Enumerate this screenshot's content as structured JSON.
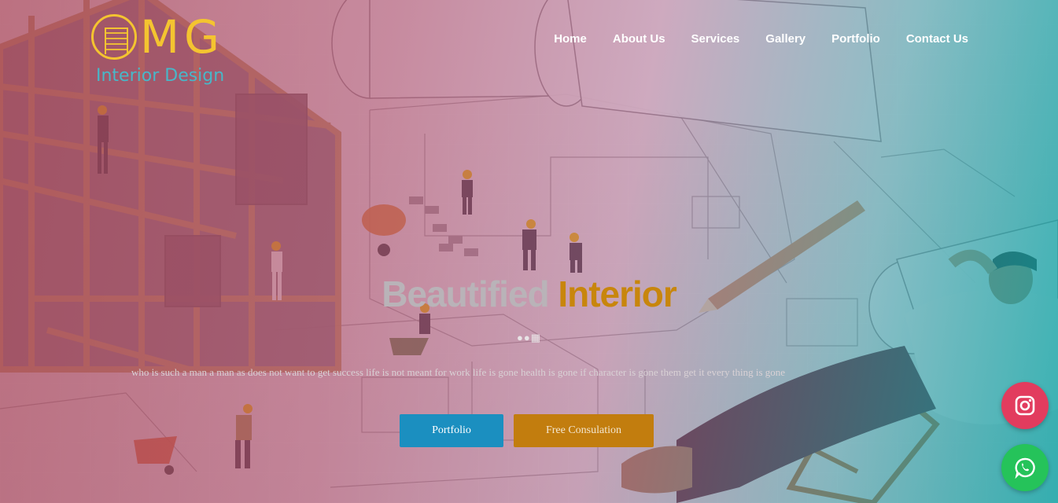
{
  "brand": {
    "logo_letters": "MG",
    "logo_subtitle": "Interior Design",
    "colors": {
      "logo": "#f4c430",
      "subtitle": "#48b7c8"
    }
  },
  "nav": {
    "items": [
      {
        "label": "Home"
      },
      {
        "label": "About Us"
      },
      {
        "label": "Services"
      },
      {
        "label": "Gallery"
      },
      {
        "label": "Portfolio"
      },
      {
        "label": "Contact Us"
      }
    ]
  },
  "hero": {
    "title_part1": "Beautified",
    "title_part2": "Interior",
    "platform_icons": [
      "apple-icon",
      "android-icon",
      "windows-icon"
    ],
    "description": "who is such a man a man as does not want to get success life is not meant for work life is gone health is gone if character is gone them get it every thing is gone",
    "buttons": {
      "portfolio": "Portfolio",
      "consultation": "Free Consulation"
    },
    "colors": {
      "title_part1": "#b9b3b8",
      "title_part2": "#c8860c",
      "portfolio_button": "#1b8fc0",
      "consultation_button": "#c27d0e"
    }
  },
  "social": {
    "instagram": {
      "icon": "instagram-icon",
      "color": "#e23c5e"
    },
    "whatsapp": {
      "icon": "whatsapp-icon",
      "color": "#25c35a"
    }
  }
}
